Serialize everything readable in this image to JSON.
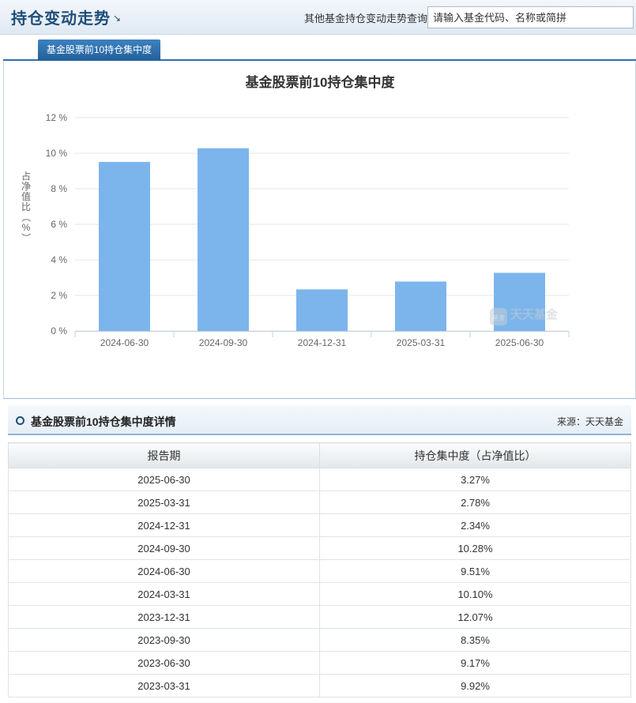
{
  "header": {
    "title": "持仓变动走势",
    "title_arrow": "↘",
    "search_label": "其他基金持仓变动走势查询:",
    "search_placeholder": "请输入基金代码、名称或简拼"
  },
  "tabs": [
    {
      "label": "基金股票前10持仓集中度",
      "active": true
    }
  ],
  "watermark": "天天基金",
  "chart_data": {
    "type": "bar",
    "title": "基金股票前10持仓集中度",
    "ylabel": "占净值比（%）",
    "xlabel": "",
    "categories": [
      "2024-06-30",
      "2024-09-30",
      "2024-12-31",
      "2025-03-31",
      "2025-06-30"
    ],
    "values": [
      9.51,
      10.28,
      2.34,
      2.78,
      3.27
    ],
    "ylim": [
      0,
      12
    ],
    "yticks": [
      0,
      2,
      4,
      6,
      8,
      10,
      12
    ],
    "ytick_suffix": " %",
    "bar_color": "#7cb5ec",
    "grid": true,
    "legend": "none"
  },
  "detail": {
    "title": "基金股票前10持仓集中度详情",
    "source": "来源：天天基金",
    "columns": [
      "报告期",
      "持仓集中度（占净值比）"
    ],
    "rows": [
      [
        "2025-06-30",
        "3.27%"
      ],
      [
        "2025-03-31",
        "2.78%"
      ],
      [
        "2024-12-31",
        "2.34%"
      ],
      [
        "2024-09-30",
        "10.28%"
      ],
      [
        "2024-06-30",
        "9.51%"
      ],
      [
        "2024-03-31",
        "10.10%"
      ],
      [
        "2023-12-31",
        "12.07%"
      ],
      [
        "2023-09-30",
        "8.35%"
      ],
      [
        "2023-06-30",
        "9.17%"
      ],
      [
        "2023-03-31",
        "9.92%"
      ]
    ]
  }
}
